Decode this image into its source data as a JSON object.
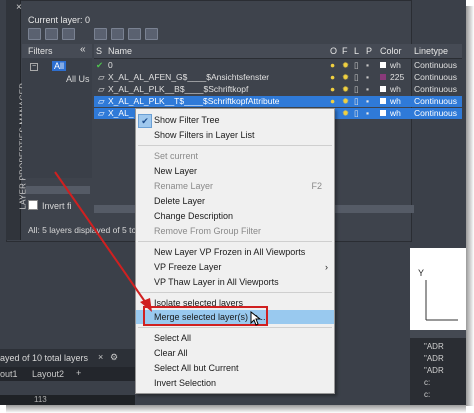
{
  "palette": {
    "side_title": "LAYER PROPERTIES MANAGER",
    "current_layer": "Current layer: 0",
    "filters_header": "Filters",
    "collapse_label": "«",
    "tree_all": "All",
    "tree_all_used": "All Us",
    "invert_label": "Invert fi",
    "status": "All: 5 layers displayed of 5 to",
    "columns": [
      "S",
      "Name",
      "O",
      "F",
      "L",
      "P",
      "Color",
      "Linetype"
    ],
    "rows": [
      {
        "name": "0",
        "color_label": "wh",
        "linetype": "Continuous",
        "swatch": "#ffffff",
        "selected": false
      },
      {
        "name": "X_AL_AL_AFEN_G$____$Ansichtsfenster",
        "color_label": "225",
        "linetype": "Continuous",
        "swatch": "#8a3a7a",
        "selected": false
      },
      {
        "name": "X_AL_AL_PLK__B$____$Schriftkopf",
        "color_label": "wh",
        "linetype": "Continuous",
        "swatch": "#ffffff",
        "selected": false
      },
      {
        "name": "X_AL_AL_PLK__T$____$SchriftkopfAttribute",
        "color_label": "wh",
        "linetype": "Continuous",
        "swatch": "#ffffff",
        "selected": true
      },
      {
        "name": "X_AL_",
        "color_label": "wh",
        "linetype": "Continuous",
        "swatch": "#ffffff",
        "selected": true
      }
    ]
  },
  "context_menu": {
    "items": [
      {
        "label": "Show Filter Tree",
        "checked": true
      },
      {
        "label": "Show Filters in Layer List"
      },
      {
        "sep": true
      },
      {
        "label": "Set current",
        "disabled": true
      },
      {
        "label": "New Layer"
      },
      {
        "label": "Rename Layer",
        "disabled": true,
        "shortcut": "F2"
      },
      {
        "label": "Delete Layer"
      },
      {
        "label": "Change Description"
      },
      {
        "label": "Remove From Group Filter",
        "disabled": true
      },
      {
        "sep": true
      },
      {
        "label": "New Layer VP Frozen in All Viewports"
      },
      {
        "label": "VP Freeze Layer",
        "submenu": true
      },
      {
        "label": "VP Thaw Layer in All Viewports"
      },
      {
        "sep": true
      },
      {
        "label": "Isolate selected layers"
      },
      {
        "label": "Merge selected layer(s) to ...",
        "highlighted": true
      },
      {
        "sep": true
      },
      {
        "label": "Select All"
      },
      {
        "label": "Clear All"
      },
      {
        "label": "Select All but Current"
      },
      {
        "label": "Invert Selection"
      }
    ]
  },
  "workspace": {
    "layers_status": "ayed of 10 total layers",
    "tabs": [
      "out1",
      "Layout2",
      "+"
    ],
    "command_line": "113"
  },
  "right_panel": {
    "axis_label": "Y",
    "cmd_lines": [
      "\"ADR",
      "\"ADR",
      "\"ADR",
      "c:",
      "c:"
    ]
  },
  "colors": {
    "selection": "#2f7ad8",
    "menu_highlight": "#99c9ef",
    "annotation_red": "#d02020"
  }
}
